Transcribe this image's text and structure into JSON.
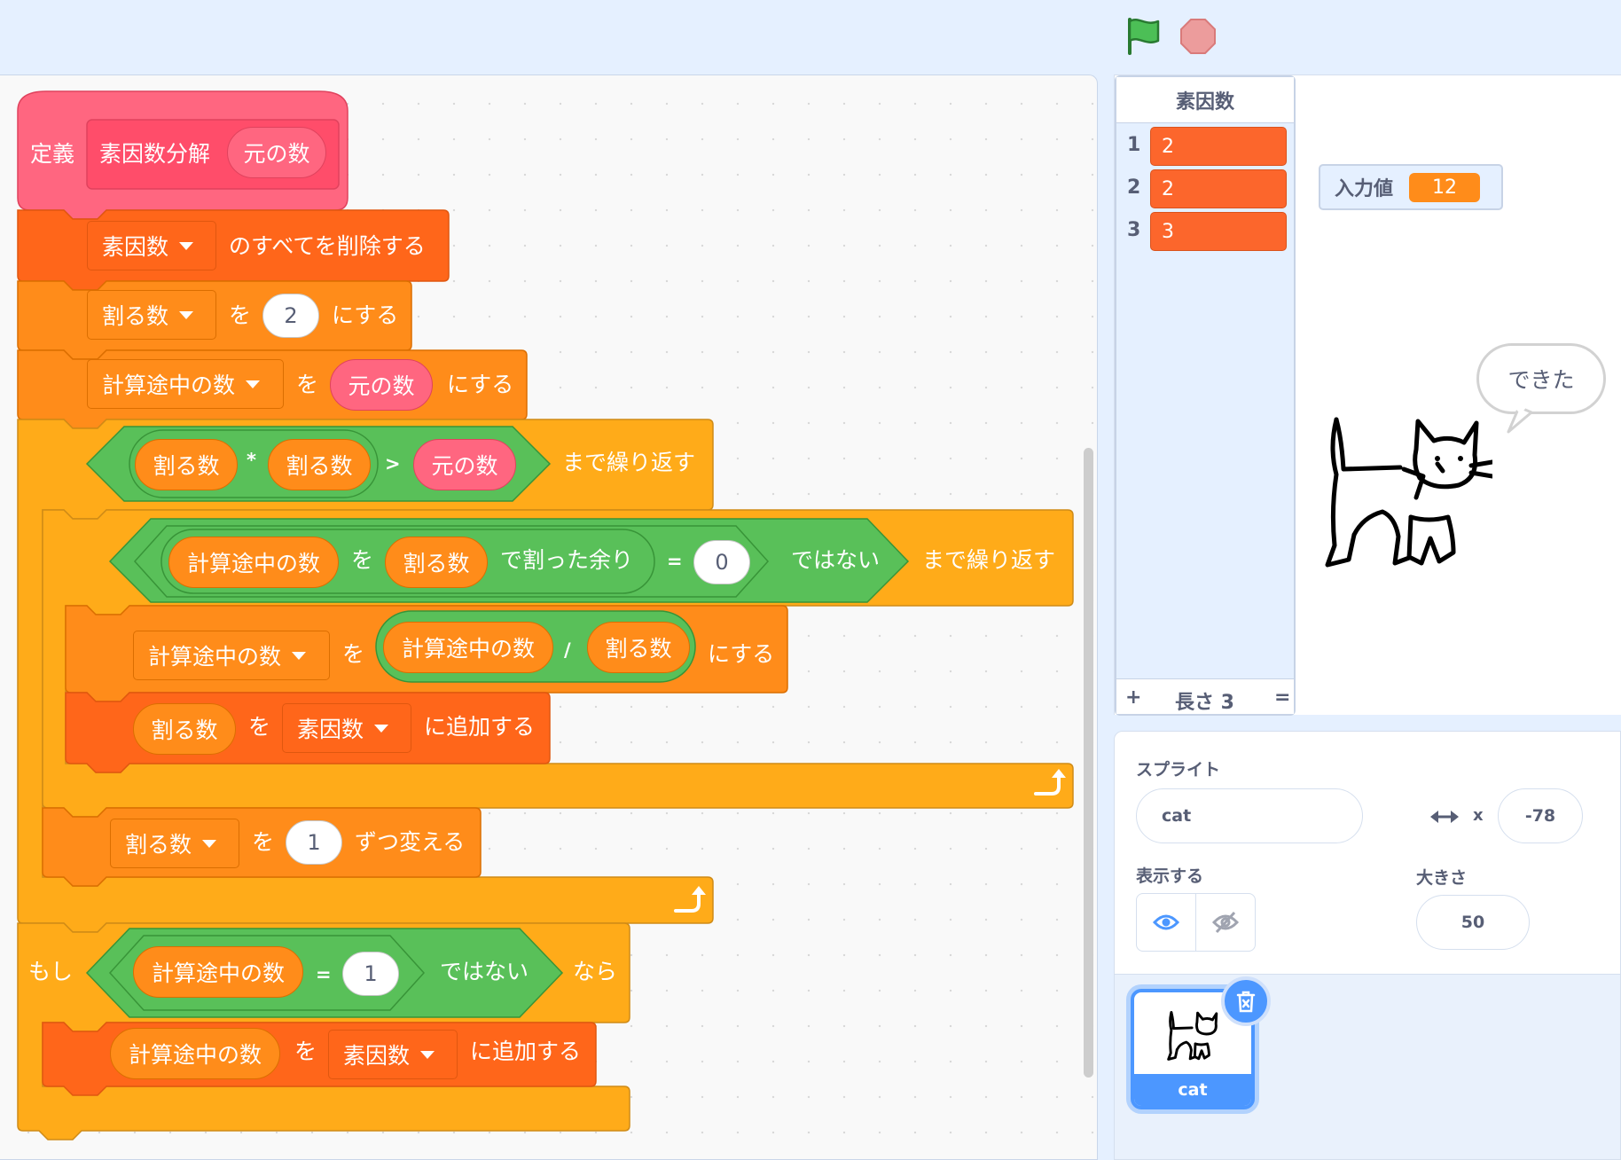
{
  "controls": {
    "green_flag": "green-flag-icon",
    "stop": "stop-icon"
  },
  "blocks": {
    "define": {
      "keyword": "定義",
      "name": "素因数分解",
      "param": "元の数"
    },
    "delete_all": {
      "list": "素因数",
      "text": "のすべてを削除する"
    },
    "set_divisor": {
      "var": "割る数",
      "to": "を",
      "value": "2",
      "suffix": "にする"
    },
    "set_working": {
      "var": "計算途中の数",
      "to": "を",
      "value": "元の数",
      "suffix": "にする"
    },
    "repeat_outer": {
      "left": "割る数",
      "mul": "*",
      "right": "割る数",
      "gt": ">",
      "param": "元の数",
      "suffix": "まで繰り返す"
    },
    "repeat_inner": {
      "a": "計算途中の数",
      "wo": "を",
      "b": "割る数",
      "mod": "で割った余り",
      "eq": "=",
      "value": "0",
      "not": "ではない",
      "suffix": "まで繰り返す"
    },
    "set_div": {
      "var": "計算途中の数",
      "to": "を",
      "a": "計算途中の数",
      "op": "/",
      "b": "割る数",
      "suffix": "にする"
    },
    "add_divisor": {
      "item": "割る数",
      "to": "を",
      "list": "素因数",
      "suffix": "に追加する"
    },
    "change_divisor": {
      "var": "割る数",
      "to": "を",
      "value": "1",
      "suffix": "ずつ変える"
    },
    "if_block": {
      "if": "もし",
      "a": "計算途中の数",
      "eq": "=",
      "value": "1",
      "not": "ではない",
      "then": "なら"
    },
    "add_working": {
      "item": "計算途中の数",
      "to": "を",
      "list": "素因数",
      "suffix": "に追加する"
    }
  },
  "stage": {
    "list_monitor": {
      "title": "素因数",
      "items": [
        {
          "index": "1",
          "value": "2"
        },
        {
          "index": "2",
          "value": "2"
        },
        {
          "index": "3",
          "value": "3"
        }
      ],
      "add": "+",
      "length": "長さ 3",
      "resize": "="
    },
    "variable_monitor": {
      "label": "入力値",
      "value": "12"
    },
    "speech": "できた"
  },
  "sprite_info": {
    "sprite_label": "スプライト",
    "sprite_name": "cat",
    "x_label": "x",
    "x_value": "-78",
    "show_label": "表示する",
    "size_label": "大きさ",
    "size_value": "50",
    "thumbnail_name": "cat"
  },
  "colors": {
    "define": "#ff6680",
    "list_block": "#ff661a",
    "variable_block": "#ff8c1a",
    "control": "#ffab19",
    "operator": "#59c059",
    "selected": "#4c97ff"
  }
}
